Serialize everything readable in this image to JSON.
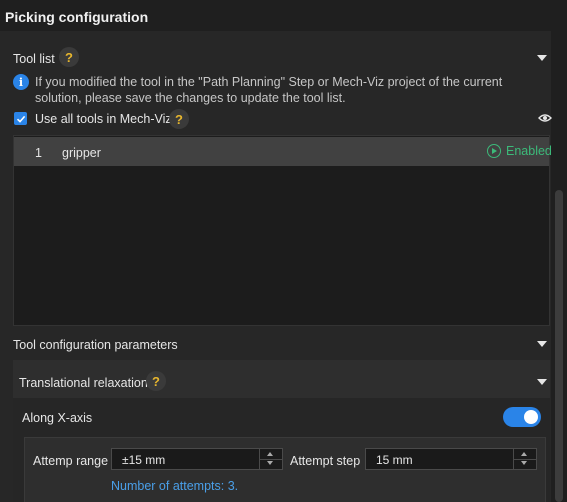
{
  "page_title": "Picking configuration",
  "tool_list": {
    "title": "Tool list",
    "help": "?",
    "info": "If you modified the tool in the \"Path Planning\" Step or Mech-Viz project of the current solution, please save the changes to update the tool list.",
    "use_all_label": "Use all tools in Mech-Viz",
    "use_all_checked": true,
    "rows": [
      {
        "index": "1",
        "name": "gripper",
        "status": "Enabled"
      }
    ]
  },
  "tool_config": {
    "title": "Tool configuration parameters"
  },
  "translational_relaxation": {
    "title": "Translational relaxation",
    "help": "?",
    "along_x": {
      "label": "Along X-axis",
      "enabled": true
    },
    "attempt_range_label": "Attemp range",
    "attempt_range_value": "±15 mm",
    "attempt_step_label": "Attempt step",
    "attempt_step_value": "15 mm",
    "attempts_note": "Number of attempts: 3."
  },
  "colors": {
    "accent": "#2a84e8",
    "enabled_green": "#3cba7a",
    "help_yellow": "#e7b62e"
  }
}
